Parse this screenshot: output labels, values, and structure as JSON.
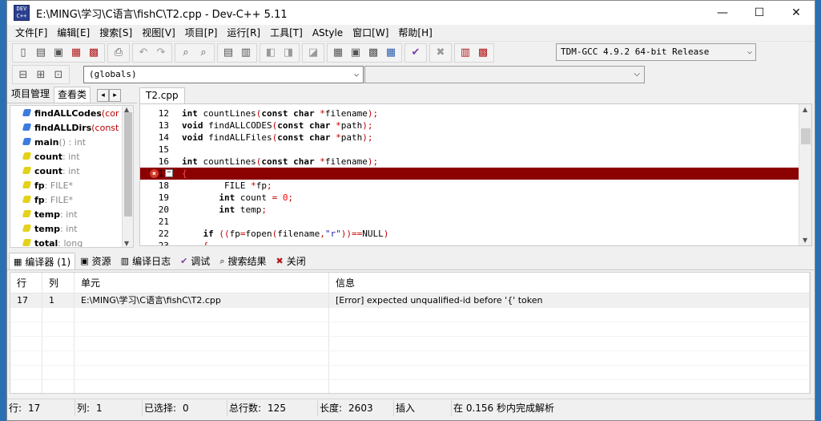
{
  "window": {
    "title": "E:\\MING\\学习\\C语言\\fishC\\T2.cpp - Dev-C++ 5.11",
    "app_icon_text": "DEV C++"
  },
  "menu": [
    "文件[F]",
    "编辑[E]",
    "搜索[S]",
    "视图[V]",
    "项目[P]",
    "运行[R]",
    "工具[T]",
    "AStyle",
    "窗口[W]",
    "帮助[H]"
  ],
  "toolbar": {
    "compiler": "TDM-GCC 4.9.2 64-bit Release"
  },
  "scope": {
    "value": "(globals)"
  },
  "left_panel": {
    "tabs": [
      "项目管理",
      "查看类"
    ],
    "items": [
      {
        "name": "findALLCodes",
        "type": "(cor",
        "kind": "fn",
        "red": true
      },
      {
        "name": "findALLDirs",
        "type": "(const",
        "kind": "fn",
        "red": true
      },
      {
        "name": "main",
        "type": "() : int",
        "kind": "fn",
        "red": false
      },
      {
        "name": "count",
        "type": ": int",
        "kind": "var",
        "red": false
      },
      {
        "name": "count",
        "type": ": int",
        "kind": "var",
        "red": false
      },
      {
        "name": "fp",
        "type": ": FILE*",
        "kind": "var",
        "red": false
      },
      {
        "name": "fp",
        "type": ": FILE*",
        "kind": "var",
        "red": false
      },
      {
        "name": "temp",
        "type": ": int",
        "kind": "var",
        "red": false
      },
      {
        "name": "temp",
        "type": ": int",
        "kind": "var",
        "red": false
      },
      {
        "name": "total",
        "type": ": long",
        "kind": "var",
        "red": false
      }
    ]
  },
  "editor": {
    "tab": "T2.cpp",
    "lines": [
      {
        "n": "12",
        "code": "int countLines(const char *filename);"
      },
      {
        "n": "13",
        "code": "void findALLCODES(const char *path);"
      },
      {
        "n": "14",
        "code": "void findALLFiles(const char *path);"
      },
      {
        "n": "15",
        "code": ""
      },
      {
        "n": "16",
        "code": "int countLines(const char *filename);"
      },
      {
        "n": "17",
        "code": "{"
      },
      {
        "n": "18",
        "code": "        FILE *fp;"
      },
      {
        "n": "19",
        "code": "       int count = 0;"
      },
      {
        "n": "20",
        "code": "       int temp;"
      },
      {
        "n": "21",
        "code": ""
      },
      {
        "n": "22",
        "code": "    if ((fp=fopen(filename,\"r\"))==NULL)"
      },
      {
        "n": "23",
        "code": "    {"
      }
    ]
  },
  "bottom_tabs": [
    {
      "label": "编译器 (1)",
      "icon": "▦"
    },
    {
      "label": "资源",
      "icon": "▣"
    },
    {
      "label": "编译日志",
      "icon": "▥"
    },
    {
      "label": "调试",
      "icon": "✔"
    },
    {
      "label": "搜索结果",
      "icon": "⌕"
    },
    {
      "label": "关闭",
      "icon": "✖"
    }
  ],
  "log": {
    "headers": [
      "行",
      "列",
      "单元",
      "信息"
    ],
    "rows": [
      {
        "line": "17",
        "col": "1",
        "unit": "E:\\MING\\学习\\C语言\\fishC\\T2.cpp",
        "msg": "[Error] expected unqualified-id before '{' token"
      }
    ]
  },
  "status": {
    "row_label": "行:",
    "row": "17",
    "col_label": "列:",
    "col": "1",
    "sel_label": "已选择:",
    "sel": "0",
    "lines_label": "总行数:",
    "lines": "125",
    "len_label": "长度:",
    "len": "2603",
    "mode": "插入",
    "parse": "在 0.156 秒内完成解析"
  }
}
